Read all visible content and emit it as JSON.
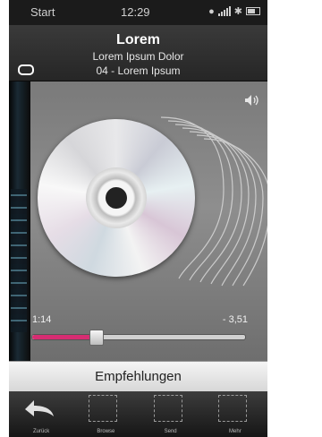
{
  "statusbar": {
    "carrier": "Start",
    "time": "12:29"
  },
  "header": {
    "title": "Lorem",
    "subtitle": "Lorem Ipsum Dolor",
    "track": "04 - Lorem Ipsum"
  },
  "player": {
    "elapsed": "1:14",
    "remaining": "- 3,51",
    "progress": 0.3,
    "accent": "#d62d72"
  },
  "recommendations_label": "Empfehlungen",
  "toolbar": {
    "items": [
      {
        "label": "Zurück",
        "icon": "back-arrow-icon"
      },
      {
        "label": "Browse",
        "icon": "placeholder-icon"
      },
      {
        "label": "Send",
        "icon": "placeholder-icon"
      },
      {
        "label": "Mehr",
        "icon": "placeholder-icon"
      }
    ]
  }
}
